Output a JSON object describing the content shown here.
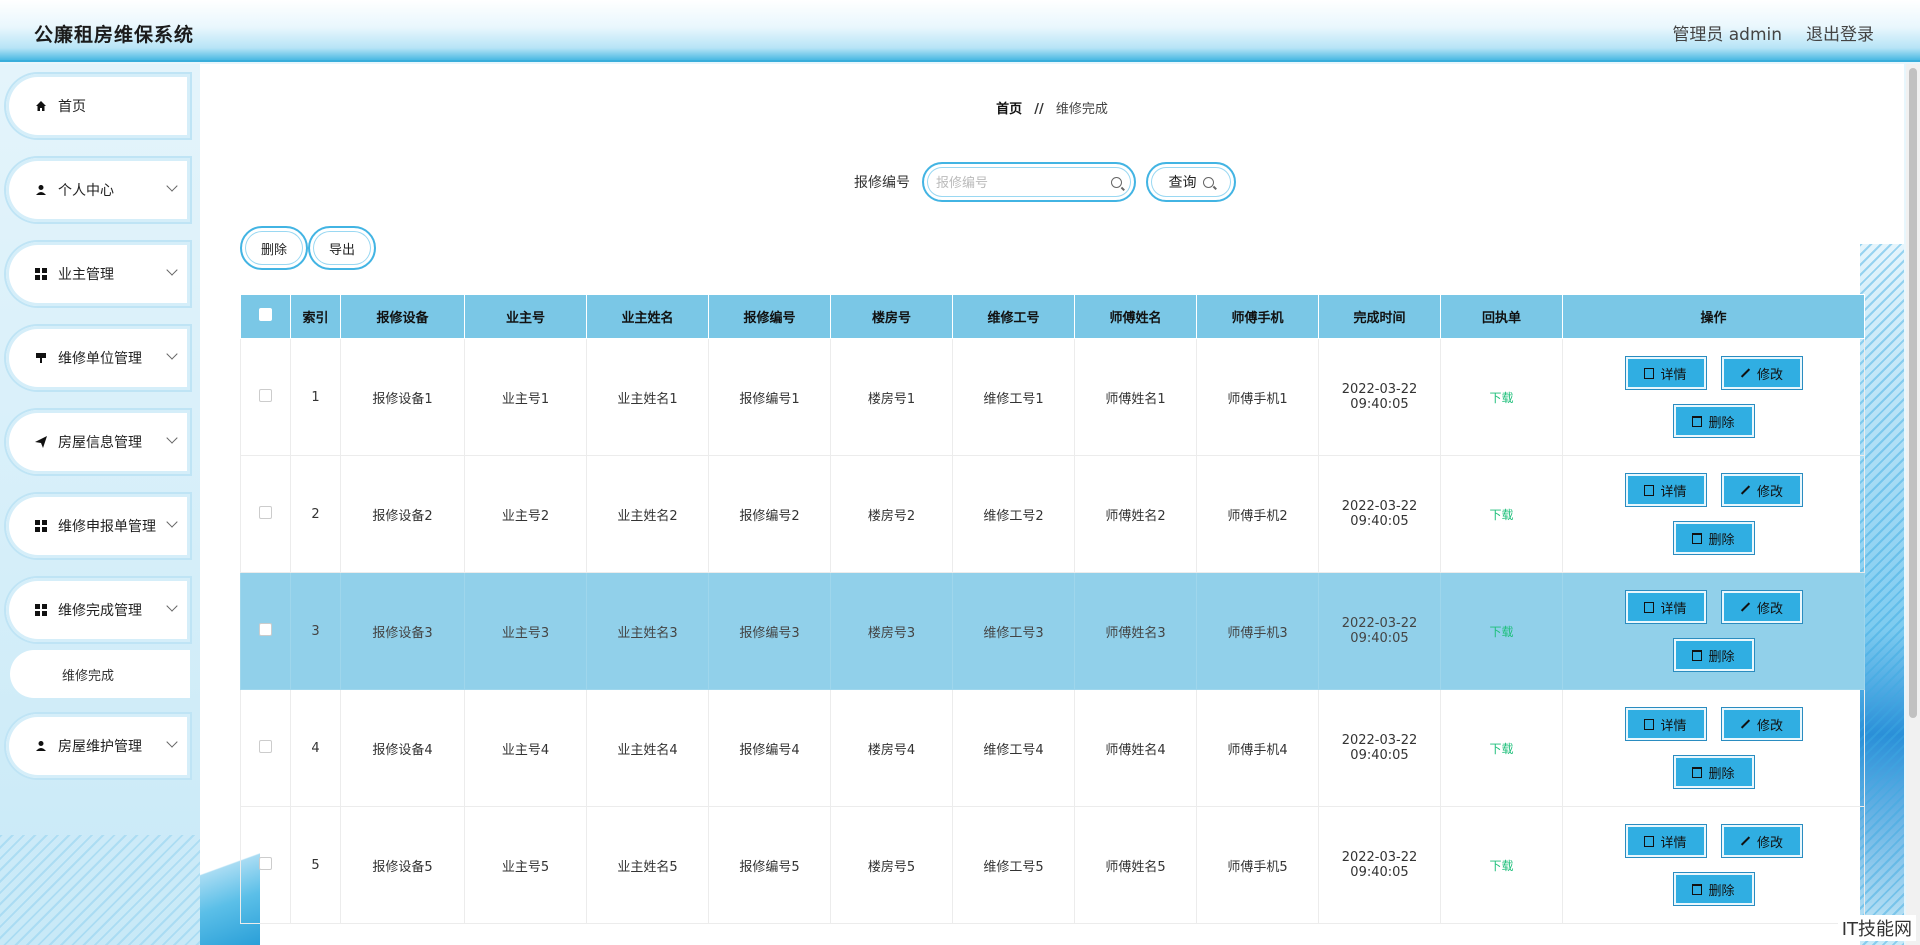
{
  "header": {
    "title": "公廉租房维保系统",
    "user": "管理员 admin",
    "logout": "退出登录"
  },
  "sidebar": {
    "items": [
      {
        "label": "首页",
        "icon": "home-icon"
      },
      {
        "label": "个人中心",
        "icon": "user-icon"
      },
      {
        "label": "业主管理",
        "icon": "grid-icon"
      },
      {
        "label": "维修单位管理",
        "icon": "grid-icon"
      },
      {
        "label": "房屋信息管理",
        "icon": "send-icon"
      },
      {
        "label": "维修申报单管理",
        "icon": "grid-icon"
      },
      {
        "label": "维修完成管理",
        "icon": "grid-icon"
      },
      {
        "label": "房屋维护管理",
        "icon": "user-icon"
      }
    ],
    "sub_item": "维修完成"
  },
  "breadcrumb": {
    "home": "首页",
    "sep": "//",
    "current": "维修完成"
  },
  "search": {
    "label": "报修编号",
    "placeholder": "报修编号",
    "button": "查询"
  },
  "actions": {
    "delete": "删除",
    "export": "导出"
  },
  "table": {
    "columns": [
      "索引",
      "报修设备",
      "业主号",
      "业主姓名",
      "报修编号",
      "楼房号",
      "维修工号",
      "师傅姓名",
      "师傅手机",
      "完成时间",
      "回执单",
      "操作"
    ],
    "rows": [
      {
        "idx": "1",
        "device": "报修设备1",
        "owner_no": "业主号1",
        "owner_name": "业主姓名1",
        "repair_no": "报修编号1",
        "building": "楼房号1",
        "worker_no": "维修工号1",
        "master": "师傅姓名1",
        "phone": "师傅手机1",
        "time": "2022-03-22 09:40:05",
        "receipt": "下载"
      },
      {
        "idx": "2",
        "device": "报修设备2",
        "owner_no": "业主号2",
        "owner_name": "业主姓名2",
        "repair_no": "报修编号2",
        "building": "楼房号2",
        "worker_no": "维修工号2",
        "master": "师傅姓名2",
        "phone": "师傅手机2",
        "time": "2022-03-22 09:40:05",
        "receipt": "下载"
      },
      {
        "idx": "3",
        "device": "报修设备3",
        "owner_no": "业主号3",
        "owner_name": "业主姓名3",
        "repair_no": "报修编号3",
        "building": "楼房号3",
        "worker_no": "维修工号3",
        "master": "师傅姓名3",
        "phone": "师傅手机3",
        "time": "2022-03-22 09:40:05",
        "receipt": "下载"
      },
      {
        "idx": "4",
        "device": "报修设备4",
        "owner_no": "业主号4",
        "owner_name": "业主姓名4",
        "repair_no": "报修编号4",
        "building": "楼房号4",
        "worker_no": "维修工号4",
        "master": "师傅姓名4",
        "phone": "师傅手机4",
        "time": "2022-03-22 09:40:05",
        "receipt": "下载"
      },
      {
        "idx": "5",
        "device": "报修设备5",
        "owner_no": "业主号5",
        "owner_name": "业主姓名5",
        "repair_no": "报修编号5",
        "building": "楼房号5",
        "worker_no": "维修工号5",
        "master": "师傅姓名5",
        "phone": "师傅手机5",
        "time": "2022-03-22 09:40:05",
        "receipt": "下载"
      }
    ],
    "ops": {
      "detail": "详情",
      "edit": "修改",
      "delete": "删除"
    }
  },
  "watermark": "IT技能网",
  "colors": {
    "accent": "#30aee2",
    "header_row": "#7ac7e6",
    "highlight_row": "#91d0ea",
    "link": "#1ebf7a"
  }
}
